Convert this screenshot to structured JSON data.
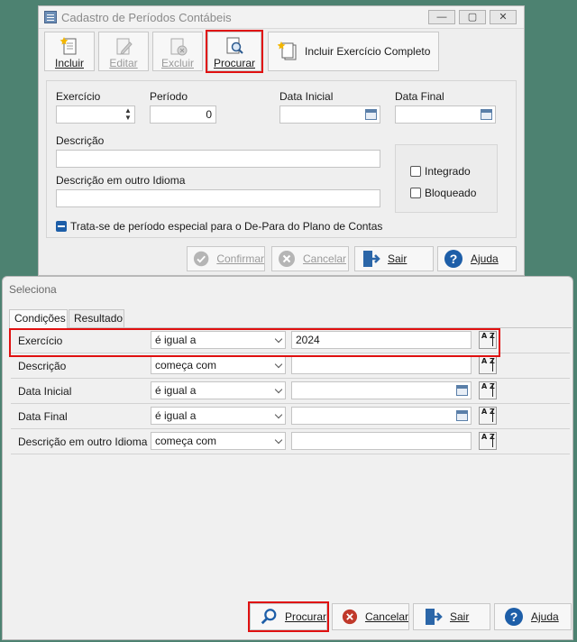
{
  "window1": {
    "title": "Cadastro de Períodos Contábeis",
    "controls": [
      "—",
      "▢",
      "✕"
    ],
    "toolbar": {
      "incluir": "Incluir",
      "editar": "Editar",
      "excluir": "Excluir",
      "procurar": "Procurar",
      "incluir_exercicio": "Incluir Exercício Completo"
    },
    "form": {
      "exercicio_label": "Exercício",
      "exercicio_value": "",
      "periodo_label": "Período",
      "periodo_value": "0",
      "data_inicial_label": "Data Inicial",
      "data_inicial_value": "",
      "data_final_label": "Data Final",
      "data_final_value": "",
      "descricao_label": "Descrição",
      "descricao_value": "",
      "descricao_idioma_label": "Descrição em outro Idioma",
      "descricao_idioma_value": "",
      "integrado_label": "Integrado",
      "bloqueado_label": "Bloqueado",
      "periodo_especial_label": "Trata-se de período especial para o De-Para do Plano de Contas"
    },
    "buttons": {
      "confirmar": "Confirmar",
      "cancelar": "Cancelar",
      "sair": "Sair",
      "ajuda": "Ajuda"
    }
  },
  "window2": {
    "title": "Seleciona",
    "tabs": [
      "Condições",
      "Resultado"
    ],
    "conditions": [
      {
        "field": "Exercício",
        "operator": "é igual a",
        "value": "2024"
      },
      {
        "field": "Descrição",
        "operator": "começa com",
        "value": ""
      },
      {
        "field": "Data Inicial",
        "operator": "é igual a",
        "value": ""
      },
      {
        "field": "Data Final",
        "operator": "é igual a",
        "value": ""
      },
      {
        "field": "Descrição em outro Idioma",
        "operator": "começa com",
        "value": ""
      }
    ],
    "sort_glyph": "A Z",
    "buttons": {
      "procurar": "Procurar",
      "cancelar": "Cancelar",
      "sair": "Sair",
      "ajuda": "Ajuda"
    }
  },
  "colors": {
    "background": "#4d8271",
    "highlight": "#e01010",
    "accent_blue": "#1d5ea8",
    "cancel_red": "#c0392b",
    "confirm_gray": "#b5b5b5"
  },
  "icons": [
    "add-document-icon",
    "edit-document-icon",
    "delete-document-icon",
    "search-document-icon",
    "check-icon",
    "x-icon",
    "exit-door-icon",
    "help-icon",
    "calendar-icon",
    "sort-icon",
    "magnifier-icon"
  ]
}
